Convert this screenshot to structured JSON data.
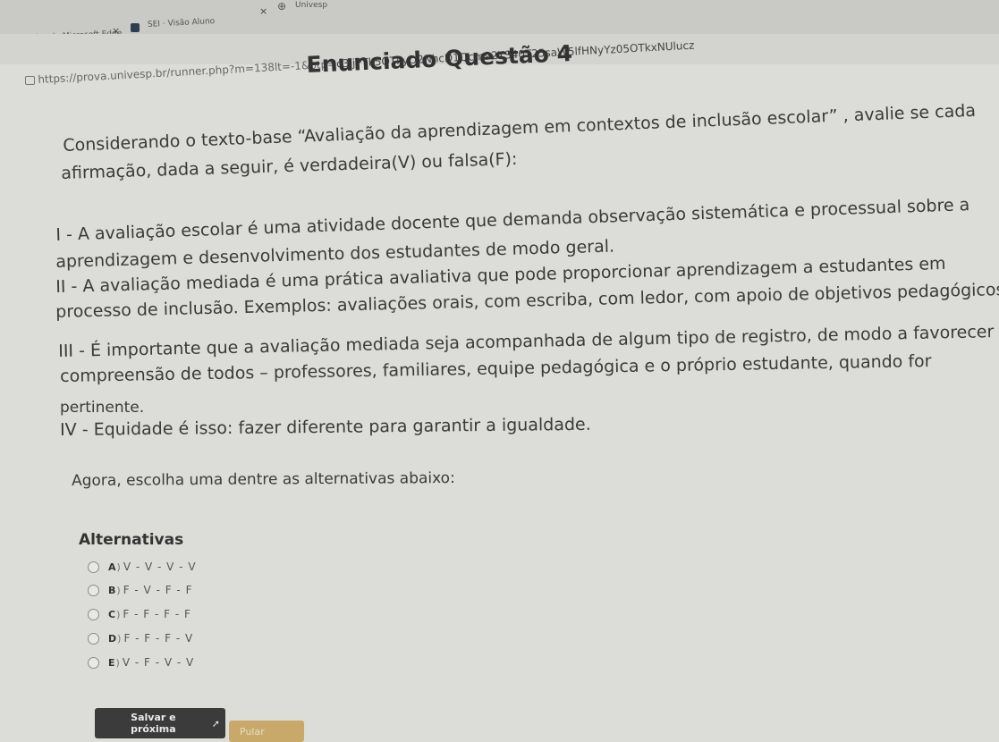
{
  "browser": {
    "tabs": [
      {
        "label": "Atividades de Microsoft Edge",
        "close": "×"
      },
      {
        "label": "SEI · Visão Aluno",
        "close": "×"
      },
      {
        "label": "Univesp"
      }
    ],
    "url_prefix": "https://prova.univesp.br/runner.php?m=138lt=-1&ptp=",
    "url_rest": "c3JjPTk5OTkyO2NhcD1Qcm92YS40T25saW5lfHNyYz05OTkxNUlucz"
  },
  "question": {
    "title": "Enunciado Questão 4",
    "intro_line1": "Considerando o texto-base “Avaliação da aprendizagem em contextos de inclusão escolar” , avalie se cada",
    "intro_line2": "afirmação, dada a seguir, é verdadeira(V) ou falsa(F):",
    "s1_line1": "I - A avaliação escolar é uma atividade docente que demanda observação sistemática e processual sobre a",
    "s1_line2": "aprendizagem e desenvolvimento dos estudantes de modo geral.",
    "s2_line1": "II - A avaliação mediada é uma prática avaliativa que pode proporcionar aprendizagem a estudantes em",
    "s2_line2": "processo de inclusão. Exemplos: avaliações orais, com escriba, com ledor, com apoio de objetivos pedagógicos.",
    "s3_line1": "III - É importante que a avaliação mediada seja acompanhada de algum tipo de registro, de modo a favorecer a",
    "s3_line2": "compreensão de todos – professores, familiares, equipe pedagógica e o próprio estudante, quando for",
    "s3_line3": "pertinente.",
    "s4_line1": "IV - Equidade é isso: fazer diferente para garantir a igualdade.",
    "prompt": "Agora, escolha uma dentre as alternativas abaixo:"
  },
  "alternatives": {
    "heading": "Alternativas",
    "items": [
      {
        "letter": "A",
        "text": "V - V - V - V"
      },
      {
        "letter": "B",
        "text": "F - V - F - F"
      },
      {
        "letter": "C",
        "text": "F - F - F - F"
      },
      {
        "letter": "D",
        "text": "F - F - F - V"
      },
      {
        "letter": "E",
        "text": "V - F - V - V"
      }
    ]
  },
  "buttons": {
    "save_label": "Salvar e próxima",
    "skip_label": "Pular"
  },
  "icons": {
    "save_arrow": "➚",
    "lock": "lock-icon"
  },
  "colors": {
    "save_bg": "#3b3b3b",
    "skip_bg": "#c8a96a"
  }
}
